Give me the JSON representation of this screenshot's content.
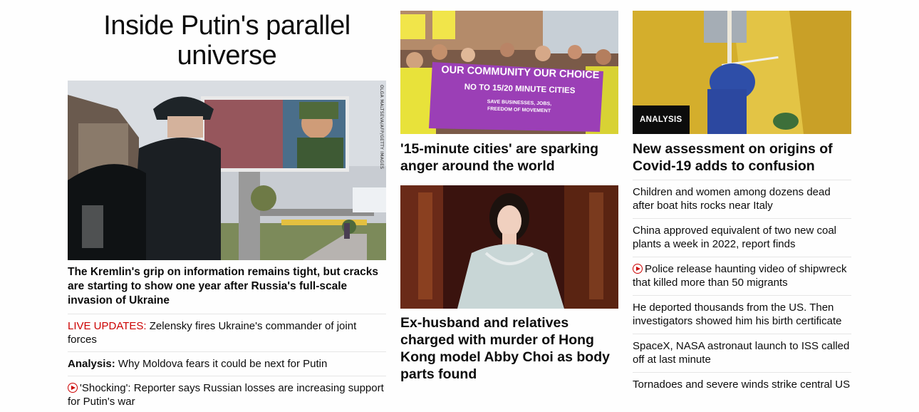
{
  "col1": {
    "title": "Inside Putin's parallel universe",
    "photo_credit": "OLGA MALTSEVA/AFP/GETTY IMAGES",
    "headline": "The Kremlin's grip on information remains tight, but cracks are starting to show one year after Russia's full-scale invasion of Ukraine",
    "links": [
      {
        "prefix": "LIVE UPDATES:",
        "text": " Zelensky fires Ukraine's commander of joint forces"
      },
      {
        "prefix": "Analysis:",
        "text": " Why Moldova fears it could be next for Putin"
      },
      {
        "text": "'Shocking': Reporter says Russian losses are increasing support for Putin's war",
        "icon": "play-icon"
      }
    ]
  },
  "col2": {
    "card1": {
      "headline": "'15-minute cities' are sparking anger around the world",
      "banner_line1": "OUR COMMUNITY OUR CHOICE",
      "banner_line2": "NO TO 15/20 MINUTE CITIES",
      "banner_line3": "SAVE BUSINESSES, JOBS,",
      "banner_line4": "FREEDOM OF MOVEMENT"
    },
    "card2": {
      "headline": "Ex-husband and relatives charged with murder of Hong Kong model Abby Choi as body parts found"
    }
  },
  "col3": {
    "badge": "ANALYSIS",
    "headline": "New assessment on origins of Covid-19 adds to confusion",
    "links": [
      {
        "text": "Children and women among dozens dead after boat hits rocks near Italy"
      },
      {
        "text": "China approved equivalent of two new coal plants a week in 2022, report finds"
      },
      {
        "text": "Police release haunting video of shipwreck that killed more than 50 migrants",
        "icon": "play-icon"
      },
      {
        "text": "He deported thousands from the US. Then investigators showed him his birth certificate"
      },
      {
        "text": "SpaceX, NASA astronaut launch to ISS called off at last minute"
      },
      {
        "text": "Tornadoes and severe winds strike central US"
      }
    ]
  },
  "colors": {
    "live": "#cc0000",
    "text": "#0c0c0c",
    "divider": "#e6e6e6"
  }
}
